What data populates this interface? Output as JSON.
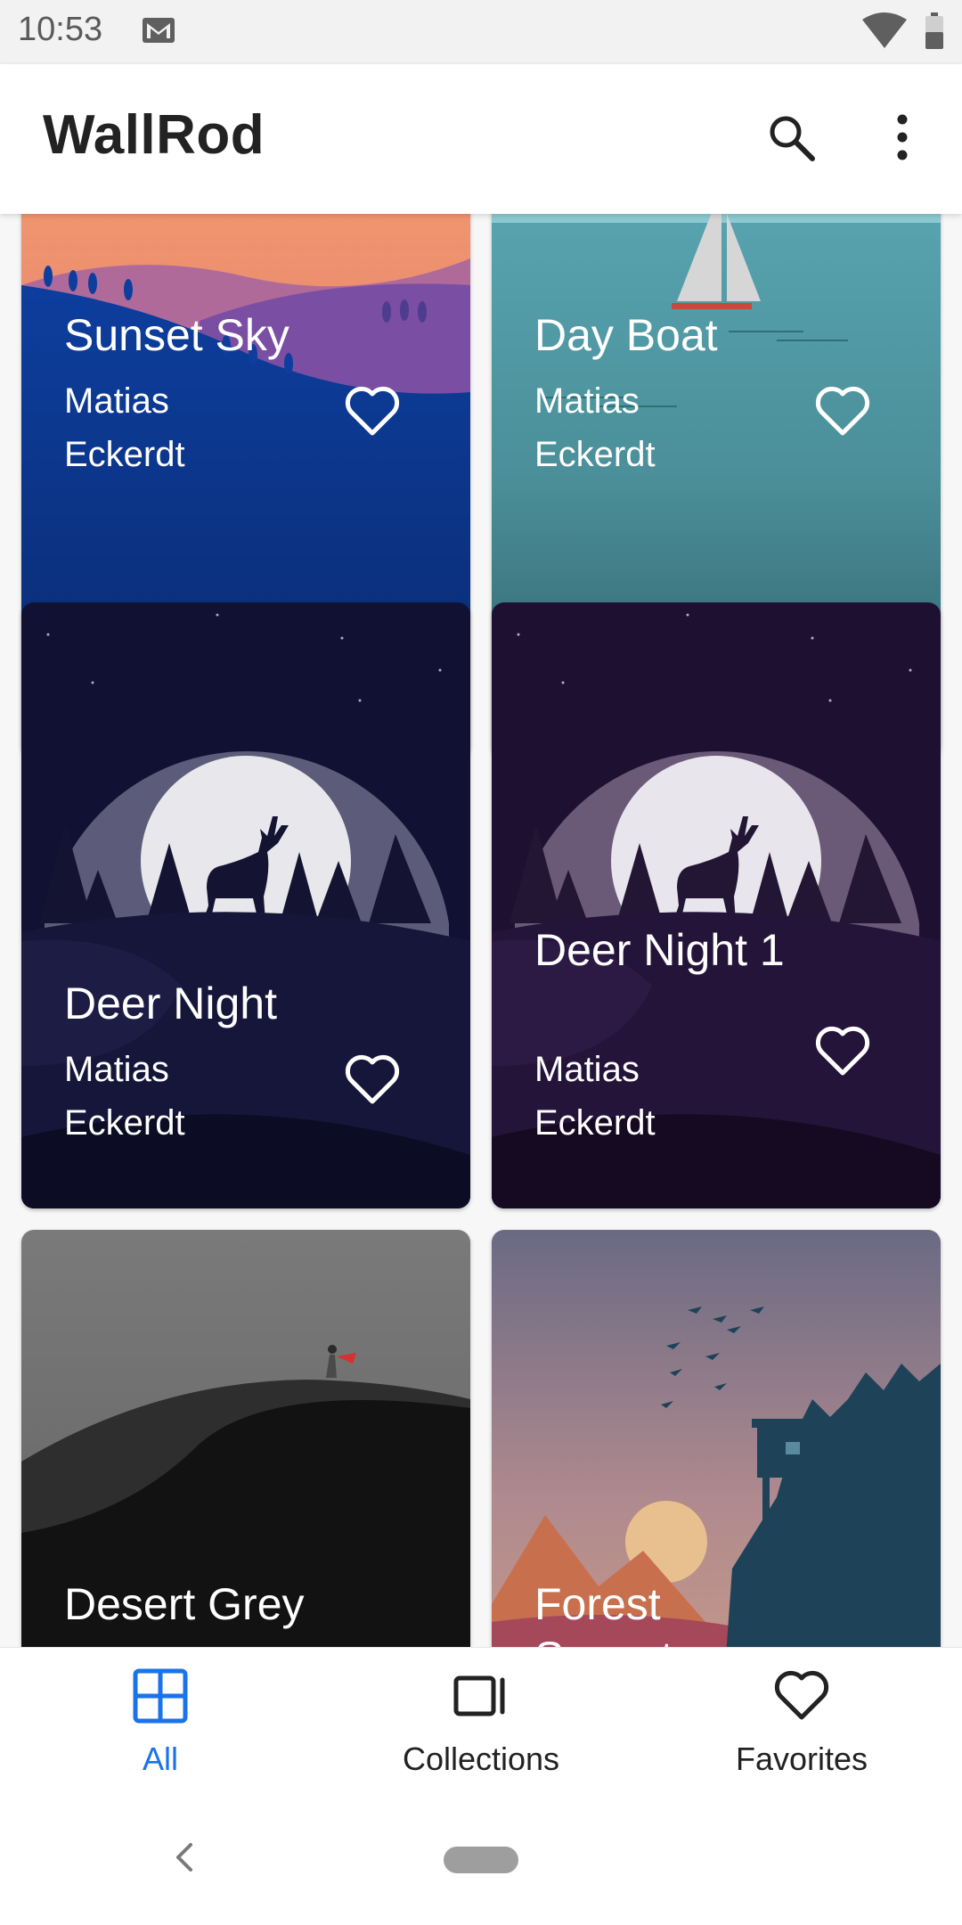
{
  "status_bar": {
    "time": "10:53",
    "icons": [
      "mail-icon",
      "wifi-icon",
      "battery-icon"
    ]
  },
  "app_bar": {
    "title": "WallRod",
    "actions": [
      "search-icon",
      "more-vert-icon"
    ]
  },
  "wallpapers": [
    {
      "title": "Sunset Sky",
      "author": "Matias Eckerdt"
    },
    {
      "title": "Day Boat",
      "author": "Matias Eckerdt"
    },
    {
      "title": "Deer Night",
      "author": "Matias Eckerdt"
    },
    {
      "title": "Deer Night 1",
      "author": "Matias Eckerdt"
    },
    {
      "title": "Desert Grey",
      "author": ""
    },
    {
      "title": "Forest Sunset",
      "author": ""
    }
  ],
  "bottom_nav": {
    "items": [
      {
        "label": "All",
        "icon": "grid-icon",
        "active": true
      },
      {
        "label": "Collections",
        "icon": "collections-icon",
        "active": false
      },
      {
        "label": "Favorites",
        "icon": "heart-icon",
        "active": false
      }
    ]
  },
  "colors": {
    "accent": "#1a73e8",
    "app_bar": "#ffffff",
    "text": "#222222"
  }
}
